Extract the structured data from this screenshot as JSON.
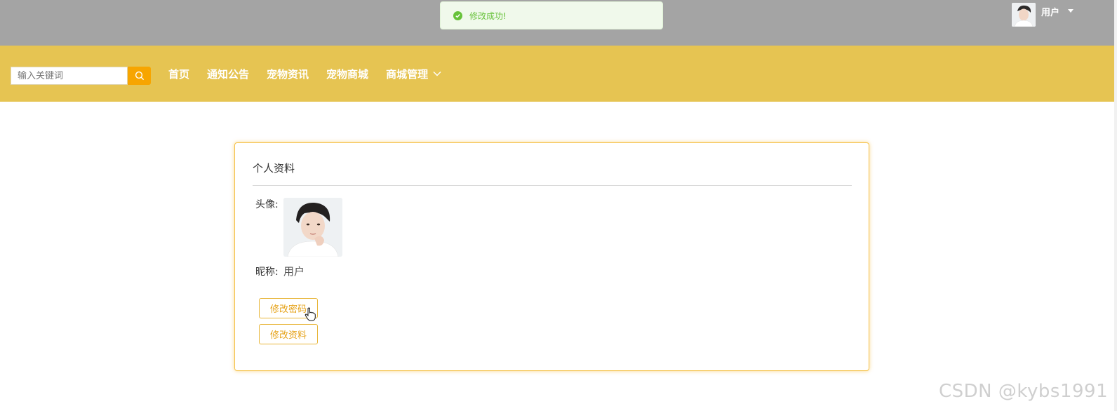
{
  "toast": {
    "message": "修改成功!",
    "icon": "check-circle-icon",
    "color": "#67c23a"
  },
  "header": {
    "user_name": "用户",
    "avatar_icon": "user-avatar-photo"
  },
  "search": {
    "placeholder": "输入关键词",
    "button_icon": "search-icon"
  },
  "nav": {
    "items": [
      {
        "label": "首页"
      },
      {
        "label": "通知公告"
      },
      {
        "label": "宠物资讯"
      },
      {
        "label": "宠物商城"
      },
      {
        "label": "商城管理",
        "has_dropdown": true
      }
    ]
  },
  "profile": {
    "title": "个人资料",
    "avatar_label": "头像:",
    "nickname_label": "昵称:",
    "nickname_value": "用户",
    "change_password_label": "修改密码",
    "edit_profile_label": "修改资料"
  },
  "watermark": "CSDN @kybs1991",
  "colors": {
    "topbar": "#a4a4a4",
    "navbar": "#e6c452",
    "accent": "#f7a500",
    "card_border": "#f5c24a"
  }
}
